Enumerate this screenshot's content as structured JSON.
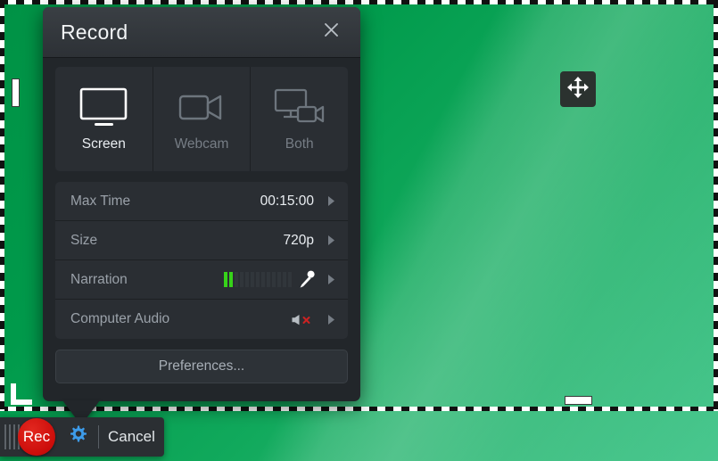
{
  "desktop": {
    "background_color": "#00a14b",
    "selection": {
      "handles": [
        "left-edge-handle",
        "bottom-edge-handle",
        "bottom-left-corner-handle"
      ]
    },
    "move_widget": {
      "icon": "move-arrows-icon"
    }
  },
  "dialog": {
    "title": "Record",
    "close_icon": "close-icon",
    "modes": [
      {
        "label": "Screen",
        "icon": "monitor-icon",
        "selected": true
      },
      {
        "label": "Webcam",
        "icon": "camcorder-icon",
        "selected": false
      },
      {
        "label": "Both",
        "icon": "monitor-camera-icon",
        "selected": false
      }
    ],
    "settings": [
      {
        "label": "Max Time",
        "value": "00:15:00",
        "chevron": "chevron-right-icon"
      },
      {
        "label": "Size",
        "value": "720p",
        "chevron": "chevron-right-icon"
      },
      {
        "label": "Narration",
        "value": "",
        "chevron": "chevron-right-icon",
        "meter": {
          "total": 13,
          "active": 2,
          "active_color": "#37d21a",
          "inactive_color": "#31363b"
        },
        "icon": "microphone-icon"
      },
      {
        "label": "Computer Audio",
        "value": "",
        "chevron": "chevron-right-icon",
        "icon": "speaker-muted-icon",
        "muted": true,
        "mute_mark_color": "#cc2222"
      }
    ],
    "preferences_label": "Preferences..."
  },
  "toolbar": {
    "grip_icon": "drag-grip-icon",
    "rec_label": "Rec",
    "rec_color": "#cc0d0a",
    "gear_icon": "gear-icon",
    "gear_color": "#3d9be9",
    "cancel_label": "Cancel"
  }
}
